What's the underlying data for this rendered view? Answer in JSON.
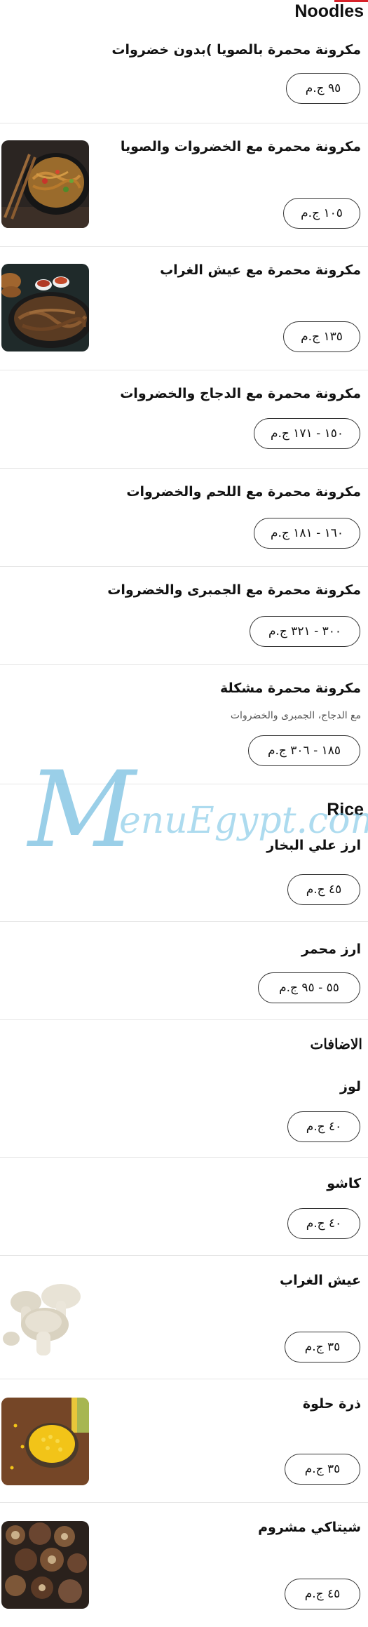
{
  "sections": {
    "noodles": "Noodles",
    "rice": "Rice",
    "extras": "الاضافات"
  },
  "watermark": {
    "initial": "M",
    "text": "enuEgypt.com"
  },
  "items": [
    {
      "name": "مكرونة محمرة بالصويا )بدون خضروات",
      "price": "٩٥ ج.م"
    },
    {
      "name": "مكرونة محمرة مع الخضروات والصويا",
      "price": "١٠٥ ج.م",
      "image": "noodles-veg-photo"
    },
    {
      "name": "مكرونة محمرة مع عيش الغراب",
      "price": "١٣٥ ج.م",
      "image": "noodles-mushroom-photo"
    },
    {
      "name": "مكرونة محمرة مع الدجاج والخضروات",
      "price": "١٥٠ - ١٧١ ج.م"
    },
    {
      "name": "مكرونة محمرة مع اللحم والخضروات",
      "price": "١٦٠ - ١٨١ ج.م"
    },
    {
      "name": "مكرونة محمرة مع الجمبرى والخضروات",
      "price": "٣٠٠ - ٣٢١ ج.م"
    },
    {
      "name": "مكرونة محمرة مشكلة",
      "description": "مع الدجاج، الجمبرى والخضروات",
      "price": "١٨٥ - ٣٠٦ ج.م"
    },
    {
      "name": "ارز علي البخار",
      "price": "٤٥ ج.م"
    },
    {
      "name": "ارز محمر",
      "price": "٥٥ - ٩٥ ج.م"
    },
    {
      "name": "لوز",
      "price": "٤٠ ج.م"
    },
    {
      "name": "كاشو",
      "price": "٤٠ ج.م"
    },
    {
      "name": "عيش الغراب",
      "price": "٣٥ ج.م",
      "image": "mushroom-photo"
    },
    {
      "name": "ذرة حلوة",
      "price": "٣٥ ج.م",
      "image": "sweet-corn-photo"
    },
    {
      "name": "شيتاكي مشروم",
      "price": "٤٥ ج.م",
      "image": "shiitake-photo"
    }
  ]
}
